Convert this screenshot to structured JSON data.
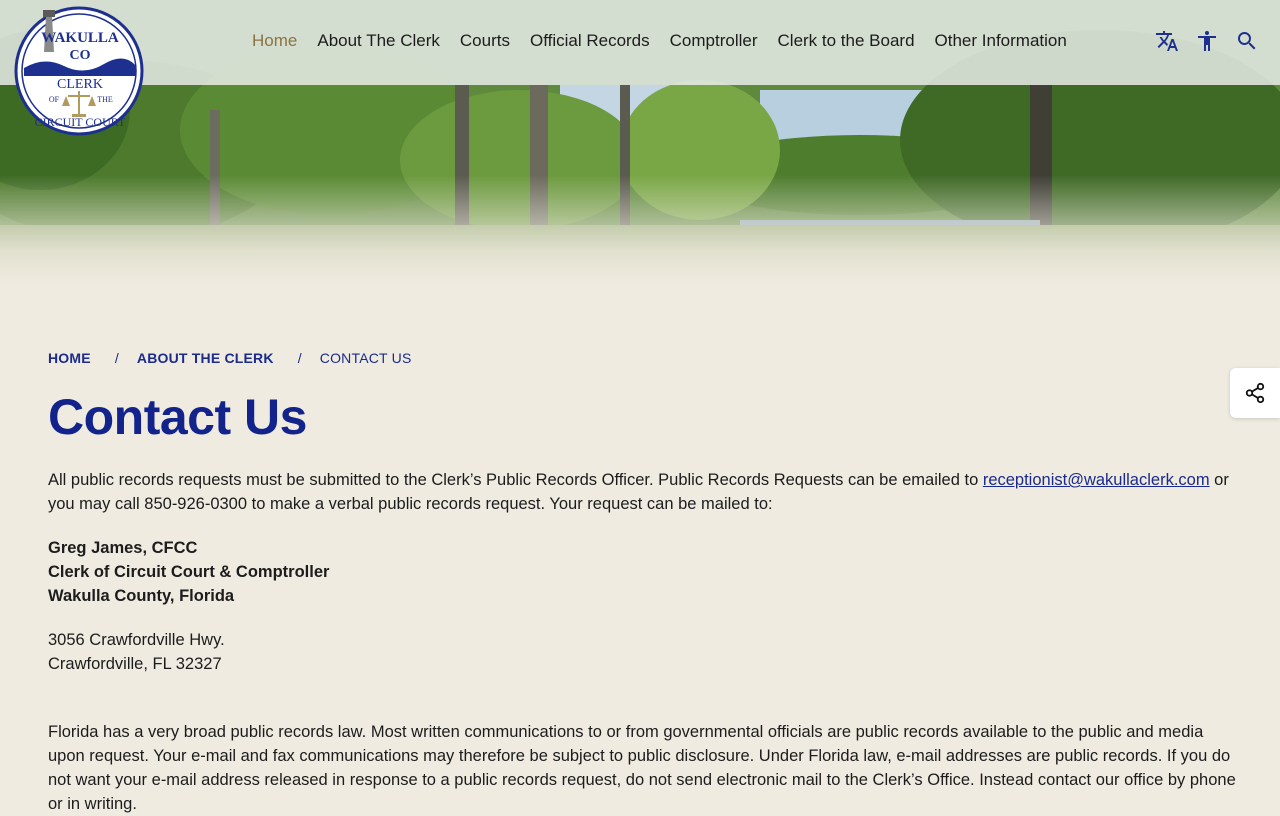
{
  "logo": {
    "top_text": "WAKULLA",
    "county_abbrev": "CO",
    "line_clerk": "CLERK",
    "line_of": "OF",
    "line_the": "THE",
    "bottom_text": "CIRCUIT COURT",
    "colors": {
      "navy": "#1d2f8f",
      "gold": "#b09a5e"
    }
  },
  "nav": {
    "items": [
      {
        "label": "Home",
        "active": true
      },
      {
        "label": "About The Clerk",
        "active": false
      },
      {
        "label": "Courts",
        "active": false
      },
      {
        "label": "Official Records",
        "active": false
      },
      {
        "label": "Comptroller",
        "active": false
      },
      {
        "label": "Clerk to the Board",
        "active": false
      },
      {
        "label": "Other Information",
        "active": false
      }
    ],
    "icons": [
      "translate-icon",
      "accessibility-icon",
      "search-icon"
    ]
  },
  "breadcrumb": {
    "home": "HOME",
    "parent": "ABOUT THE CLERK",
    "current": "CONTACT US",
    "separator": "/"
  },
  "page": {
    "title": "Contact Us",
    "intro_before": "All public records requests must be submitted to the Clerk’s Public Records Officer. Public Records Requests can be emailed to ",
    "email": "receptionist@wakullaclerk.com",
    "intro_after": " or you may call 850-926-0300 to make a verbal public records request. Your request can be mailed to:",
    "address_name": "Greg James, CFCC",
    "address_title": "Clerk of Circuit Court & Comptroller",
    "address_county": "Wakulla County, Florida",
    "street": "3056 Crawfordville Hwy.",
    "city": "Crawfordville, FL 32327",
    "notice": "Florida has a very broad public records law.  Most written communications to or from governmental officials are public records available to the public and media upon request.  Your e-mail and fax communications may therefore be subject to public disclosure. Under Florida law, e-mail addresses are public records. If you do not want your e-mail address released in response to a public records request, do not send electronic mail to the Clerk’s Office. Instead contact our office by phone or in writing."
  },
  "share": {
    "icon": "share-icon"
  },
  "colors": {
    "accent": "#13238c",
    "background": "#f0ebe1",
    "nav_active": "#8a7440"
  }
}
